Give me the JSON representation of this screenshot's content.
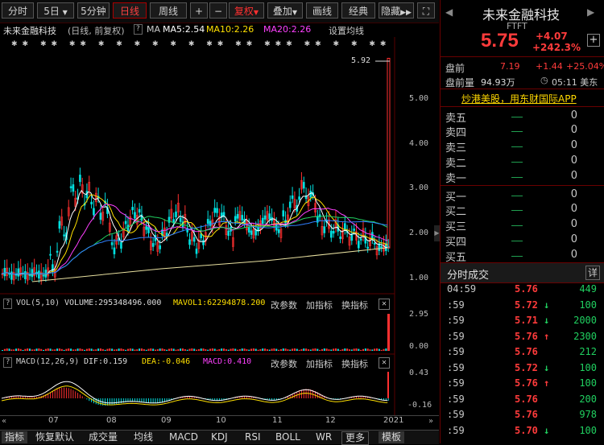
{
  "toolbar": {
    "items": [
      "分时",
      "5日",
      "5分钟",
      "日线",
      "周线",
      "+",
      "−",
      "复权",
      "叠加",
      "画线",
      "经典",
      "隐藏"
    ],
    "fullscreen_icon": "expand-icon"
  },
  "stock": {
    "name": "未来金融科技",
    "period_info": "(日线, 前复权)",
    "ma_label": "MA",
    "ma5": "MA5:2.54",
    "ma10": "MA10:2.26",
    "ma20": "MA20:2.26",
    "settings": "设置均线"
  },
  "main_chart": {
    "peak_label": "5.92",
    "y_ticks": [
      "5.00",
      "4.00",
      "3.00",
      "2.00",
      "1.00"
    ],
    "x_ticks": [
      "07",
      "08",
      "09",
      "10",
      "11",
      "12",
      "2021"
    ]
  },
  "volume": {
    "title": "VOL(5,10)",
    "volume": "VOLUME:295348496.000",
    "mavol": "MAVOL1:62294878.200",
    "change_params": "改参数",
    "add_indicator": "加指标",
    "switch_indicator": "换指标",
    "y_ticks": [
      "2.95",
      "0.00"
    ]
  },
  "macd": {
    "title": "MACD(12,26,9)",
    "dif": "DIF:0.159",
    "dea": "DEA:-0.046",
    "macd": "MACD:0.410",
    "change_params": "改参数",
    "add_indicator": "加指标",
    "switch_indicator": "换指标",
    "y_ticks": [
      "0.43",
      "-0.16"
    ]
  },
  "bottom_tabs": [
    "指标",
    "恢复默认",
    "成交量",
    "均线",
    "MACD",
    "KDJ",
    "RSI",
    "BOLL",
    "WR",
    "更多",
    "模板"
  ],
  "quote": {
    "name": "未来金融科技",
    "ticker": "FTFT",
    "price": "5.75",
    "change": "+4.07",
    "change_pct": "+242.3%",
    "premarket_label": "盘前",
    "premarket_price": "7.19",
    "premarket_change": "+1.44",
    "premarket_pct": "+25.04%",
    "premarket_vol_label": "盘前量",
    "premarket_vol": "94.93万",
    "time": "05:11 美东",
    "promo": "炒港美股，用东财国际APP"
  },
  "order_book": {
    "asks": [
      {
        "label": "卖五",
        "vol": "0"
      },
      {
        "label": "卖四",
        "vol": "0"
      },
      {
        "label": "卖三",
        "vol": "0"
      },
      {
        "label": "卖二",
        "vol": "0"
      },
      {
        "label": "卖一",
        "vol": "0"
      }
    ],
    "bids": [
      {
        "label": "买一",
        "vol": "0"
      },
      {
        "label": "买二",
        "vol": "0"
      },
      {
        "label": "买三",
        "vol": "0"
      },
      {
        "label": "买四",
        "vol": "0"
      },
      {
        "label": "买五",
        "vol": "0"
      }
    ]
  },
  "ticks": {
    "title": "分时成交",
    "detail": "详",
    "rows": [
      {
        "time": "04:59",
        "price": "5.76",
        "arrow": "",
        "vol": "449",
        "dir": "up"
      },
      {
        "time": ":59",
        "price": "5.72",
        "arrow": "↓",
        "vol": "100",
        "dir": "down"
      },
      {
        "time": ":59",
        "price": "5.71",
        "arrow": "↓",
        "vol": "2000",
        "dir": "down"
      },
      {
        "time": ":59",
        "price": "5.76",
        "arrow": "↑",
        "vol": "2300",
        "dir": "up"
      },
      {
        "time": ":59",
        "price": "5.76",
        "arrow": "",
        "vol": "212",
        "dir": "up"
      },
      {
        "time": ":59",
        "price": "5.72",
        "arrow": "↓",
        "vol": "100",
        "dir": "down"
      },
      {
        "time": ":59",
        "price": "5.76",
        "arrow": "↑",
        "vol": "100",
        "dir": "up"
      },
      {
        "time": ":59",
        "price": "5.76",
        "arrow": "",
        "vol": "200",
        "dir": "up"
      },
      {
        "time": ":59",
        "price": "5.76",
        "arrow": "",
        "vol": "978",
        "dir": "up"
      },
      {
        "time": ":59",
        "price": "5.70",
        "arrow": "↓",
        "vol": "100",
        "dir": "down"
      }
    ]
  }
}
